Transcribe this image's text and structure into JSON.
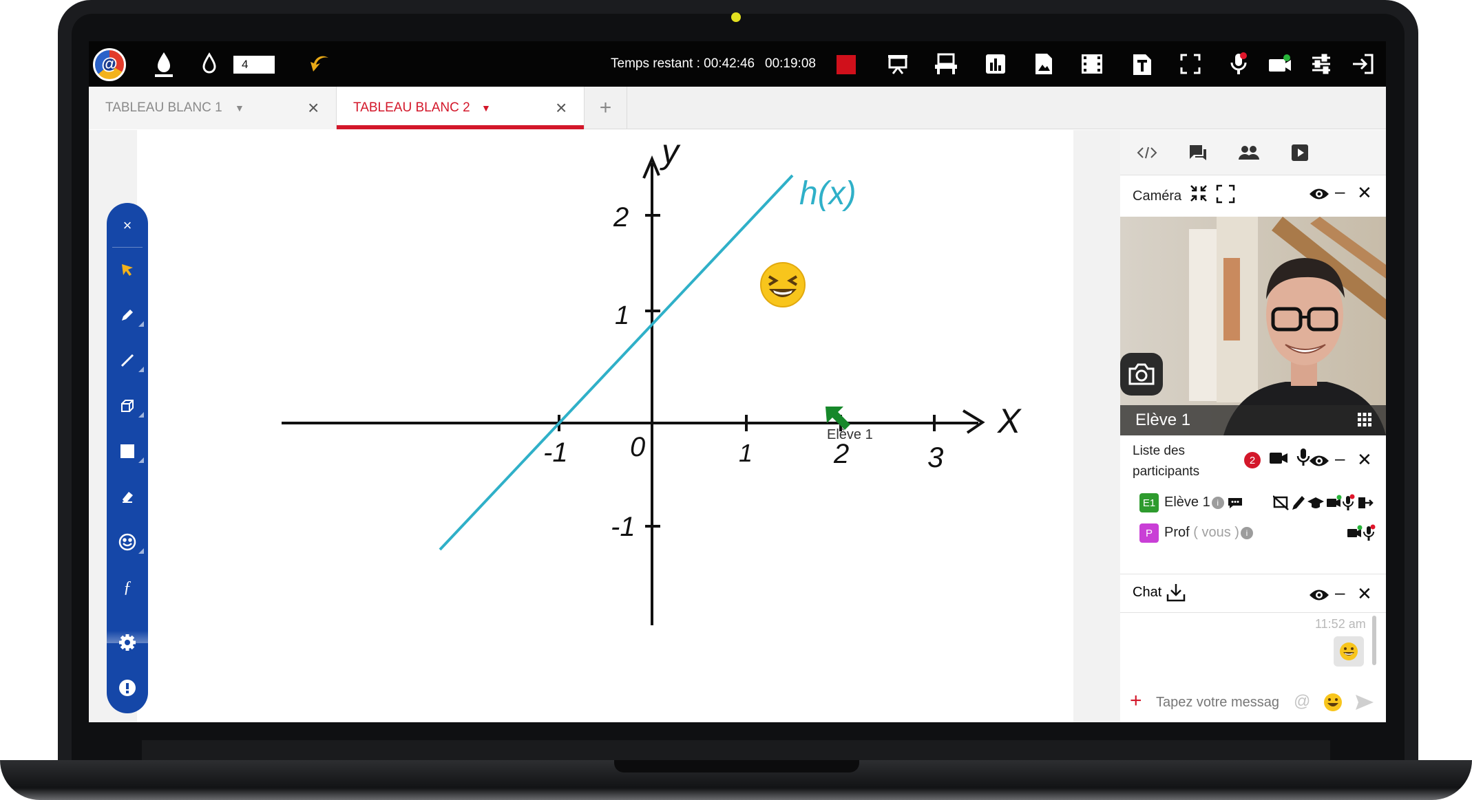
{
  "toolbar": {
    "thickness_value": "4",
    "remaining_time": "Temps restant : 00:42:46",
    "elapsed_time": "00:19:08",
    "record_color": "#d0101b"
  },
  "tabs": [
    {
      "label": "TABLEAU BLANC 1",
      "active": false
    },
    {
      "label": "TABLEAU BLANC 2",
      "active": true
    }
  ],
  "tab_add": "+",
  "board": {
    "x_axis_label": "X",
    "y_axis_label": "y",
    "function_label": "h(x)",
    "ticks_x": [
      "-1",
      "0",
      "1",
      "2",
      "3"
    ],
    "ticks_y": [
      "2",
      "1",
      "-1"
    ],
    "cursor_label": "Elève 1",
    "line_color": "#2fb0c8",
    "cursor_color": "#16882a"
  },
  "side_tools": [
    "close-icon",
    "pointer-icon",
    "pen-icon",
    "line-icon",
    "shape-3d-icon",
    "rectangle-icon",
    "eraser-icon",
    "emoji-icon",
    "function-icon",
    "gear-icon",
    "alert-icon"
  ],
  "panel": {
    "camera_title": "Caméra",
    "camera_user": "Elève 1",
    "participants_title": "Liste des participants",
    "participants_count": "2",
    "participants": [
      {
        "badge": "E1",
        "name": "Elève 1",
        "badge_color": "#2e9b2e",
        "suffix": ""
      },
      {
        "badge": "P",
        "name": "Prof",
        "badge_color": "#c93fd6",
        "suffix": "( vous )"
      }
    ],
    "chat_title": "Chat",
    "chat_time": "11:52 am",
    "chat_placeholder": "Tapez votre messag",
    "chat_at": "@"
  },
  "accent_color": "#d3172a"
}
